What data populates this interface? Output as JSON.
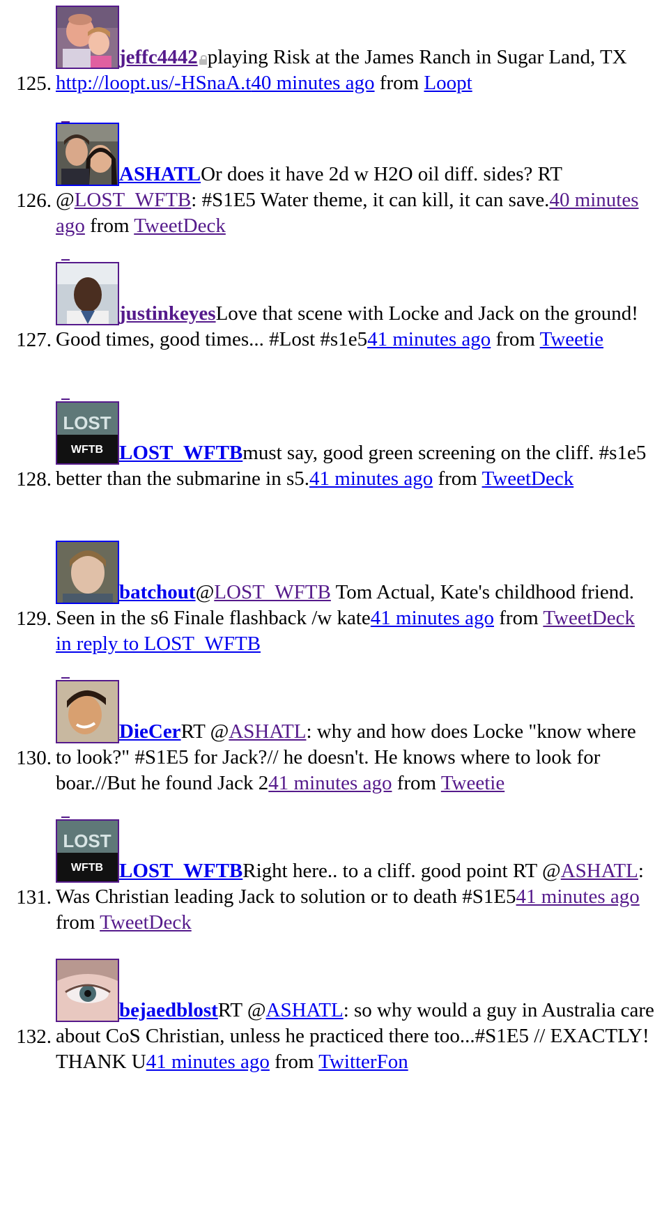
{
  "tweets": [
    {
      "number": "125.",
      "user": "jeffc4442",
      "protected": true,
      "text": "playing Risk at the James Ranch in Sugar Land, TX ",
      "link": "http://loopt.us/-HSnaA.t",
      "time": "40 minutes ago",
      "from": " from ",
      "source": "Loopt",
      "avatar_icon": "photo-man-with-child-icon"
    },
    {
      "number": "126.",
      "user": "ASHATL",
      "text_a": "Or does it have 2d w H2O oil diff. sides? RT @",
      "mention": "LOST_WFTB",
      "text_b": ": #S1E5 Water theme, it can kill, it can save.",
      "time": "40 minutes ago",
      "from": " from ",
      "source": "TweetDeck",
      "avatar_icon": "photo-couple-icon"
    },
    {
      "number": "127.",
      "user": "justinkeyes",
      "text": "Love that scene with Locke and Jack on the ground! Good times, good times... #Lost #s1e5",
      "time": "41 minutes ago",
      "from": " from ",
      "source": "Tweetie",
      "avatar_icon": "photo-man-portrait-icon"
    },
    {
      "number": "128.",
      "user": "LOST_WFTB",
      "text": "must say, good green screening on the cliff. #s1e5 better than the submarine in s5.",
      "time": "41 minutes ago",
      "from": " from ",
      "source": "TweetDeck",
      "avatar_icon": "lost-wftb-logo-icon",
      "logo_top": "LOST",
      "logo_bottom": "WFTB"
    },
    {
      "number": "129.",
      "user": "batchout",
      "text_a": "@",
      "mention": "LOST_WFTB",
      "text_b": " Tom Actual, Kate's childhood friend. Seen in the s6 Finale flashback /w kate",
      "time": "41 minutes ago",
      "from": " from ",
      "source": "TweetDeck",
      "reply": "in reply to LOST_WFTB",
      "avatar_icon": "photo-man-face-icon"
    },
    {
      "number": "130.",
      "user": "DieCer",
      "text_a": "RT @",
      "mention": "ASHATL",
      "text_b": ": why and how does Locke \"know where to look?\" #S1E5 for Jack?// he doesn't. He knows where to look for boar.//But he found Jack 2",
      "time": "41 minutes ago",
      "from": " from ",
      "source": "Tweetie",
      "avatar_icon": "photo-smiling-man-icon"
    },
    {
      "number": "131.",
      "user": "LOST_WFTB",
      "text_a": "Right here.. to a cliff. good point RT @",
      "mention": "ASHATL",
      "text_b": ": Was Christian leading Jack to solution or to death #S1E5",
      "time": "41 minutes ago",
      "from": " from ",
      "source": "TweetDeck",
      "avatar_icon": "lost-wftb-logo-icon",
      "logo_top": "LOST",
      "logo_bottom": "WFTB"
    },
    {
      "number": "132.",
      "user": "bejaedblost",
      "text_a": "RT @",
      "mention": "ASHATL",
      "text_b": ": so why would a guy in Australia care about CoS Christian, unless he practiced there too...#S1E5 // EXACTLY! THANK U",
      "time": "41 minutes ago",
      "from": " from ",
      "source": "TwitterFon",
      "avatar_icon": "photo-eye-closeup-icon"
    }
  ],
  "colors": {
    "visited_link": "#551a8b",
    "link": "#0000ee",
    "text": "#000000",
    "background": "#ffffff"
  }
}
